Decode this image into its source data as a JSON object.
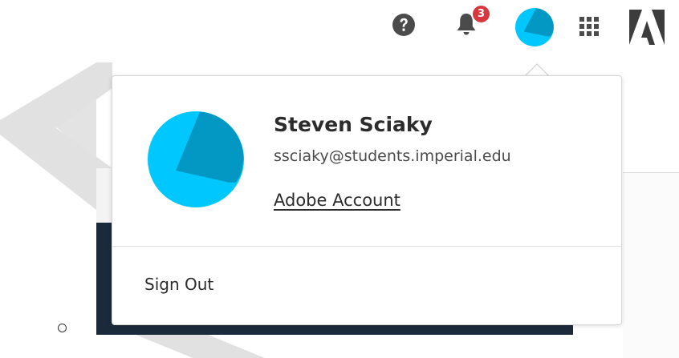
{
  "header": {
    "icons": [
      "help-icon",
      "bell-icon",
      "avatar",
      "apps-grid-icon",
      "adobe-logo-icon"
    ],
    "notification_count": "3"
  },
  "profile": {
    "name": "Steven Sciaky",
    "email": "ssciaky@students.imperial.edu",
    "account_link": "Adobe Account",
    "sign_out": "Sign Out"
  },
  "colors": {
    "avatar_light": "#00c8ff",
    "avatar_dark": "#0398c4",
    "badge": "#d7373f",
    "icon_gray": "#4b4b4b",
    "text": "#2c2c2c",
    "dark_panel": "#1b2a3a"
  }
}
